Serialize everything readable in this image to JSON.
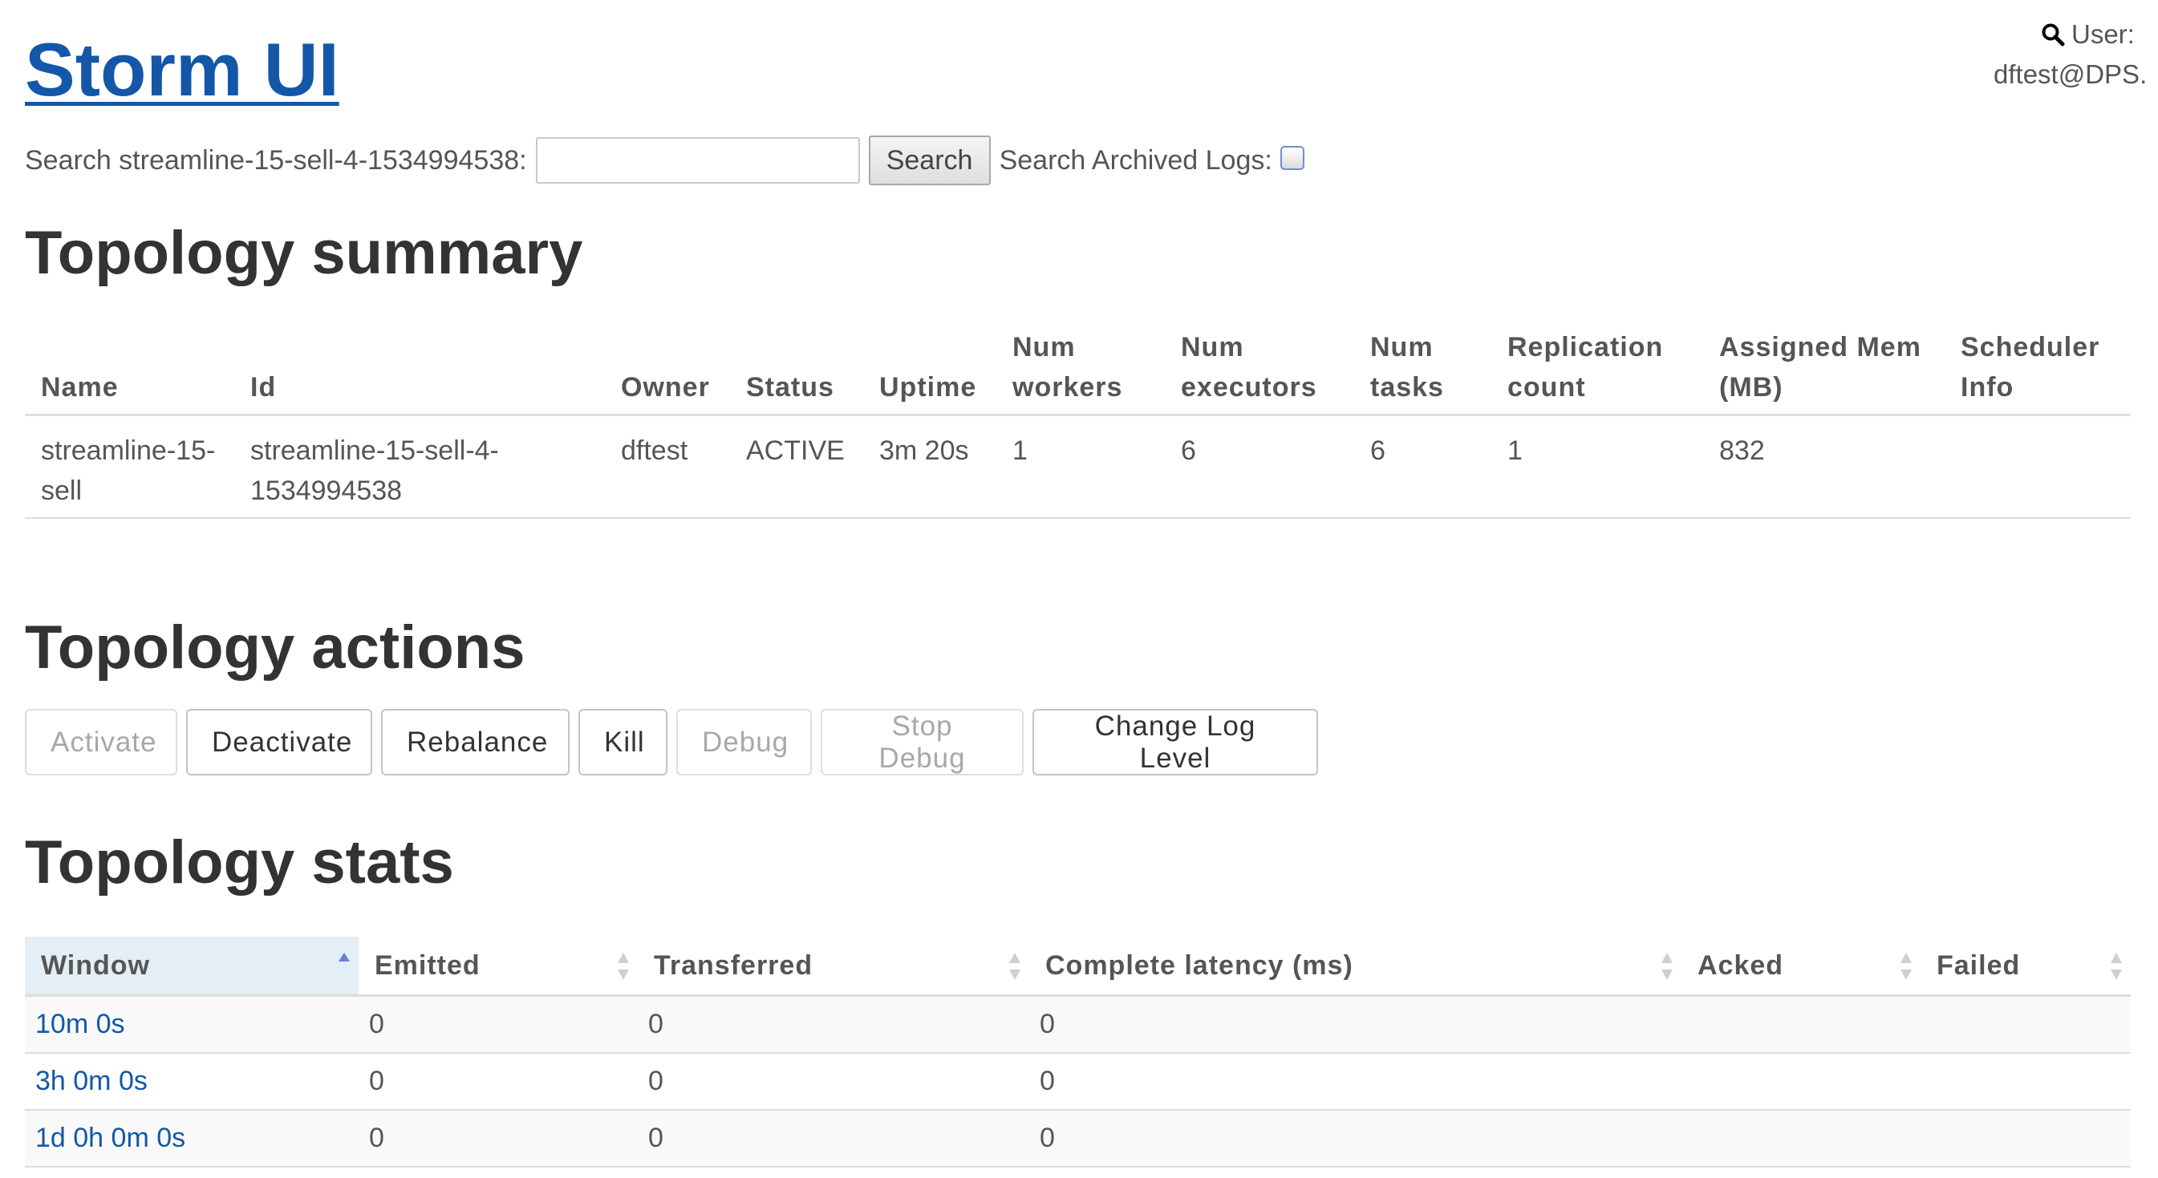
{
  "header": {
    "title": "Storm UI",
    "user_label": "User:",
    "user_name": "dftest@DPS."
  },
  "search": {
    "label": "Search streamline-15-sell-4-1534994538:",
    "value": "",
    "button_label": "Search",
    "archived_label": "Search Archived Logs:",
    "archived_checked": false
  },
  "summary": {
    "heading": "Topology summary",
    "columns": {
      "name": "Name",
      "id": "Id",
      "owner": "Owner",
      "status": "Status",
      "uptime": "Uptime",
      "num_workers": "Num workers",
      "num_executors": "Num executors",
      "num_tasks": "Num tasks",
      "replication": "Replication count",
      "assigned_mem": "Assigned Mem (MB)",
      "scheduler": "Scheduler Info"
    },
    "row": {
      "name": "streamline-15-sell",
      "id": "streamline-15-sell-4-1534994538",
      "owner": "dftest",
      "status": "ACTIVE",
      "uptime": "3m 20s",
      "num_workers": "1",
      "num_executors": "6",
      "num_tasks": "6",
      "replication": "1",
      "assigned_mem": "832",
      "scheduler": ""
    }
  },
  "actions": {
    "heading": "Topology actions",
    "buttons": [
      {
        "label": "Activate",
        "enabled": false
      },
      {
        "label": "Deactivate",
        "enabled": true
      },
      {
        "label": "Rebalance",
        "enabled": true
      },
      {
        "label": "Kill",
        "enabled": true
      },
      {
        "label": "Debug",
        "enabled": false
      },
      {
        "label": "Stop Debug",
        "enabled": false
      },
      {
        "label": "Change Log Level",
        "enabled": true
      }
    ]
  },
  "stats": {
    "heading": "Topology stats",
    "columns": {
      "window": "Window",
      "emitted": "Emitted",
      "transferred": "Transferred",
      "complete_latency": "Complete latency (ms)",
      "acked": "Acked",
      "failed": "Failed"
    },
    "rows": [
      {
        "window": "10m 0s",
        "emitted": "0",
        "transferred": "0",
        "complete_latency": "0",
        "acked": "",
        "failed": ""
      },
      {
        "window": "3h 0m 0s",
        "emitted": "0",
        "transferred": "0",
        "complete_latency": "0",
        "acked": "",
        "failed": ""
      },
      {
        "window": "1d 0h 0m 0s",
        "emitted": "0",
        "transferred": "0",
        "complete_latency": "0",
        "acked": "",
        "failed": ""
      }
    ]
  },
  "colors": {
    "link": "#1457a8",
    "sorted_header": "#e3eef6",
    "sort_active": "#6b7fd6",
    "sort_inactive": "#cfcfcf"
  }
}
